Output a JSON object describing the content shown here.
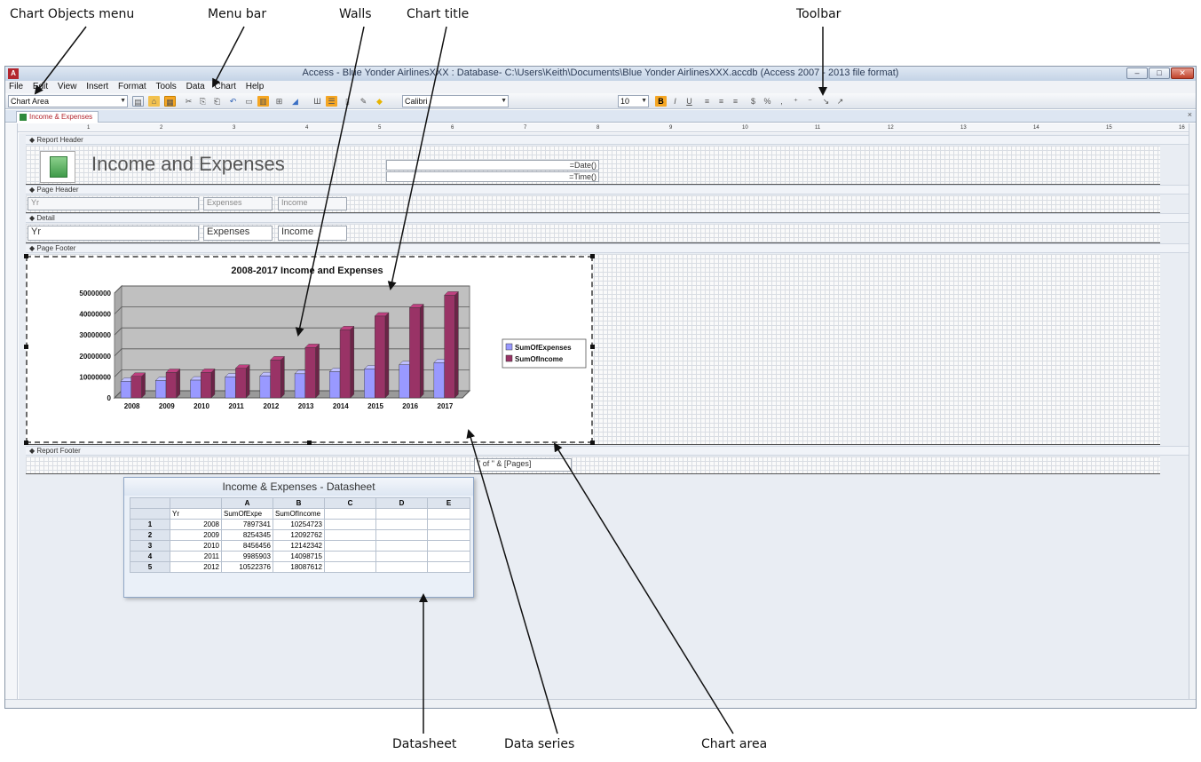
{
  "callouts": {
    "chart_objects_menu": "Chart Objects menu",
    "menu_bar": "Menu bar",
    "walls": "Walls",
    "chart_title": "Chart title",
    "toolbar": "Toolbar",
    "datasheet": "Datasheet",
    "data_series": "Data series",
    "chart_area": "Chart area"
  },
  "window": {
    "title": "Access - Blue Yonder AirlinesXXX : Database- C:\\Users\\Keith\\Documents\\Blue Yonder AirlinesXXX.accdb (Access 2007 - 2013 file format)",
    "controls": {
      "minimize": "–",
      "maximize": "□",
      "close": "✕"
    }
  },
  "menubar": [
    "File",
    "Edit",
    "View",
    "Insert",
    "Format",
    "Tools",
    "Data",
    "Chart",
    "Help"
  ],
  "toolbar": {
    "chart_objects_value": "Chart Area",
    "font_name": "Calibri",
    "font_size": "10",
    "bold": "B",
    "italic": "I",
    "underline": "U"
  },
  "document_tab": {
    "label": "Income & Expenses",
    "close": "×"
  },
  "sections": {
    "report_header": "Report Header",
    "page_header": "Page Header",
    "detail": "Detail",
    "page_footer": "Page Footer",
    "report_footer": "Report Footer"
  },
  "report": {
    "title": "Income and Expenses",
    "date_expr": "=Date()",
    "time_expr": "=Time()",
    "page_header_labels": [
      "Yr",
      "Expenses",
      "Income"
    ],
    "detail_fields": [
      "Yr",
      "Expenses",
      "Income"
    ],
    "pages_expr": "\" of \" & [Pages]"
  },
  "ruler_numbers": [
    "1",
    "2",
    "3",
    "4",
    "5",
    "6",
    "7",
    "8",
    "9",
    "10",
    "11",
    "12",
    "13",
    "14",
    "15",
    "16"
  ],
  "chart_data": {
    "type": "bar",
    "title": "2008-2017 Income and Expenses",
    "categories": [
      "2008",
      "2009",
      "2010",
      "2011",
      "2012",
      "2013",
      "2014",
      "2015",
      "2016",
      "2017"
    ],
    "series": [
      {
        "name": "SumOfExpenses",
        "color": "#9999ff",
        "values": [
          7897341,
          8254345,
          8456456,
          9985903,
          10522376,
          11500000,
          12500000,
          13800000,
          15800000,
          16800000
        ]
      },
      {
        "name": "SumOfIncome",
        "color": "#993366",
        "values": [
          10254723,
          12092762,
          12142342,
          14098715,
          18087612,
          24000000,
          32500000,
          39000000,
          43000000,
          49000000
        ]
      }
    ],
    "yticks": [
      "0",
      "10000000",
      "20000000",
      "30000000",
      "40000000",
      "50000000"
    ],
    "ylim": [
      0,
      50000000
    ],
    "legend": "right",
    "grid": true,
    "style": "3d-clustered-column"
  },
  "datasheet": {
    "title": "Income & Expenses - Datasheet",
    "columns": [
      "",
      "A",
      "B",
      "C",
      "D",
      "E"
    ],
    "header_row": [
      "",
      "Yr",
      "SumOfExpe",
      "SumOfIncome",
      "",
      "",
      ""
    ],
    "rows": [
      [
        "1",
        "2008",
        "7897341",
        "10254723"
      ],
      [
        "2",
        "2009",
        "8254345",
        "12092762"
      ],
      [
        "3",
        "2010",
        "8456456",
        "12142342"
      ],
      [
        "4",
        "2011",
        "9985903",
        "14098715"
      ],
      [
        "5",
        "2012",
        "10522376",
        "18087612"
      ]
    ]
  }
}
